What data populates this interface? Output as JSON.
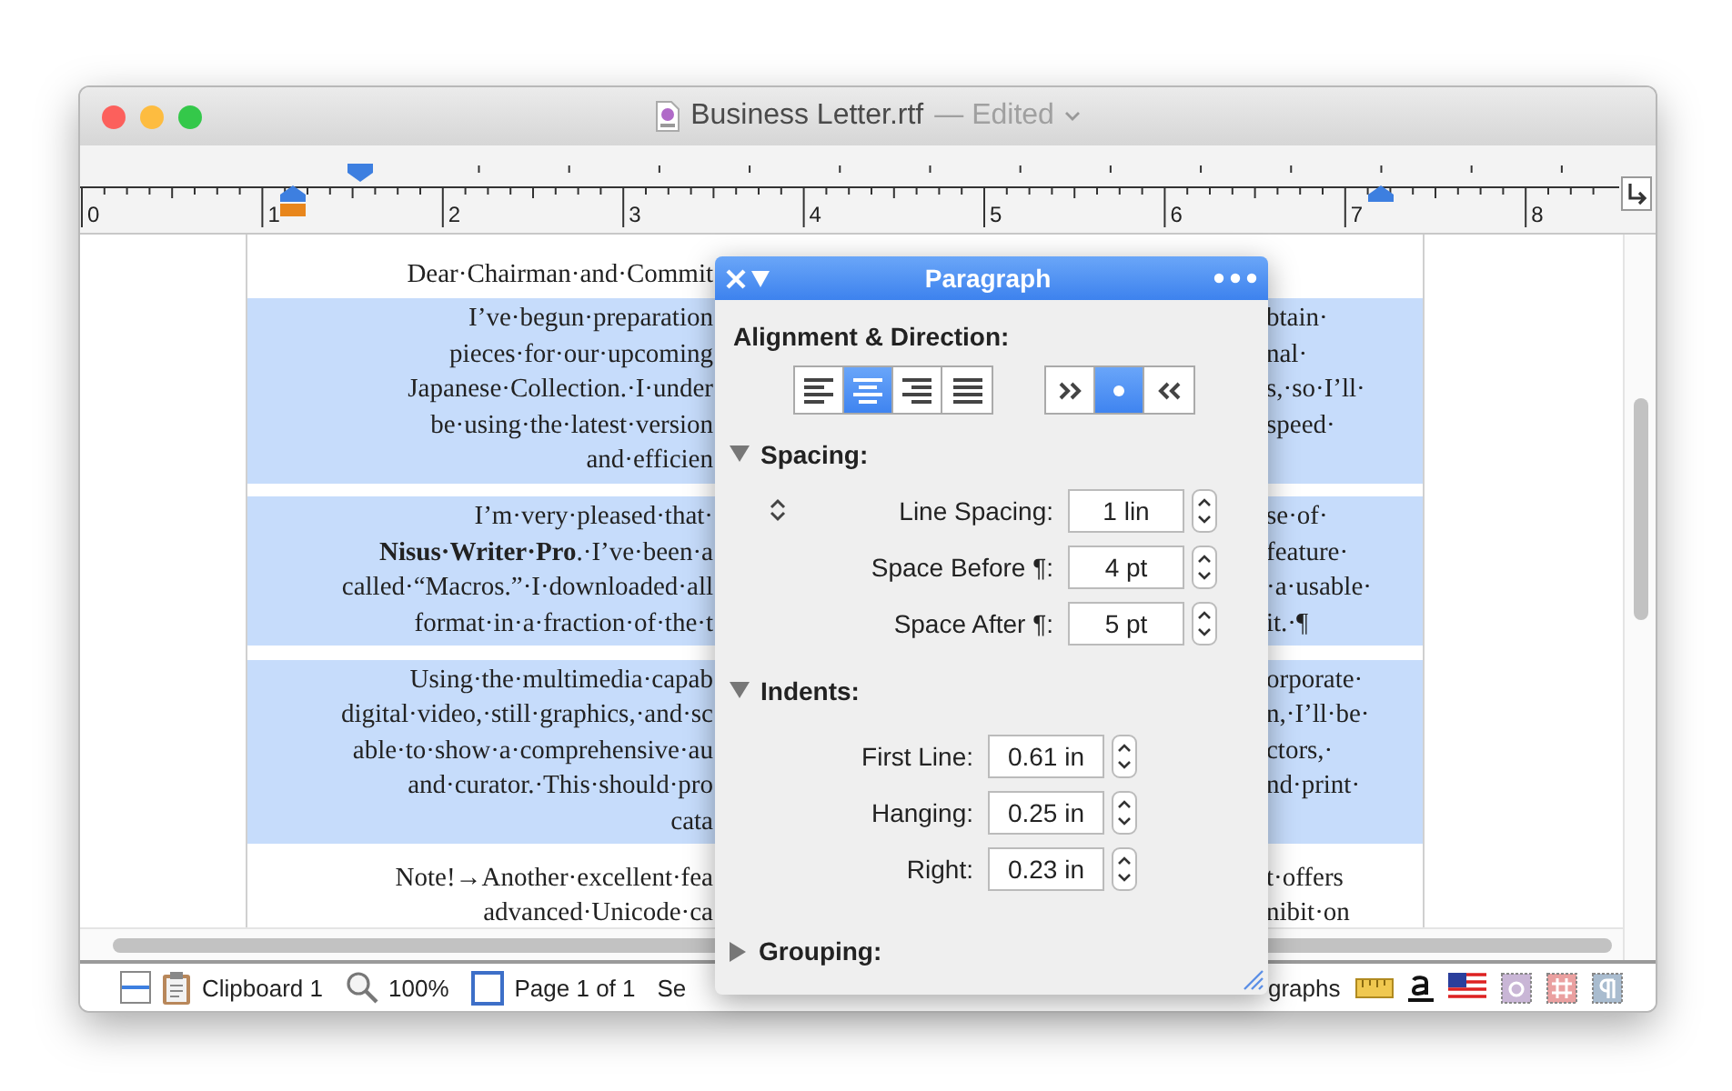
{
  "window": {
    "title": "Business Letter.rtf",
    "edited_label": "— Edited"
  },
  "ruler": {
    "numbers": [
      "0",
      "1",
      "2",
      "3",
      "4",
      "5",
      "6",
      "7",
      "8"
    ]
  },
  "document": {
    "paragraphs": [
      {
        "selected": false,
        "lines": [
          {
            "left": "Dear·Chairman·and·Commit"
          }
        ]
      },
      {
        "selected": true,
        "lines": [
          {
            "left": "I’ve·begun·preparation",
            "right": "btain·"
          },
          {
            "left": "pieces·for·our·upcoming",
            "right": "nal·"
          },
          {
            "left": "Japanese·Collection.·I·under",
            "right": "s,·so·I’ll·"
          },
          {
            "left": "be·using·the·latest·version",
            "right": "speed·"
          },
          {
            "left": "and·efficien"
          }
        ]
      },
      {
        "selected": true,
        "lines": [
          {
            "left": "I’m·very·pleased·that·",
            "right": "se·of·"
          },
          {
            "left": "**Nisus·Writer·Pro**.·I’ve·been·a",
            "right": "feature·"
          },
          {
            "left": "called·“Macros.”·I·downloaded·all",
            "right": "·a·usable·"
          },
          {
            "left": "format·in·a·fraction·of·the·t",
            "right": "it.·¶"
          }
        ]
      },
      {
        "selected": true,
        "lines": [
          {
            "left": "Using·the·multimedia·capab",
            "right": "orporate·"
          },
          {
            "left": "digital·video,·still·graphics,·and·sc",
            "right": "n,·I’ll·be·"
          },
          {
            "left": "able·to·show·a·comprehensive·au",
            "right": "ctors,·"
          },
          {
            "left": "and·curator.·This·should·pro",
            "right": "nd·print·"
          },
          {
            "left": "cata"
          }
        ]
      },
      {
        "selected": false,
        "lines": [
          {
            "left": "Note!→Another·excellent·fea",
            "right": "t·offers"
          },
          {
            "left": "advanced·Unicode·ca",
            "right": "nibit·on"
          }
        ]
      }
    ]
  },
  "status_bar": {
    "clipboard": "Clipboard 1",
    "zoom": "100%",
    "page": "Page 1 of 1",
    "section": "Se",
    "paragraph_styles": "graphs"
  },
  "panel": {
    "title": "Paragraph",
    "alignment_heading": "Alignment & Direction:",
    "alignment": [
      {
        "kind": "left",
        "selected": false
      },
      {
        "kind": "center",
        "selected": true
      },
      {
        "kind": "right",
        "selected": false
      },
      {
        "kind": "justify",
        "selected": false
      }
    ],
    "direction": [
      {
        "kind": "ltr",
        "selected": false
      },
      {
        "kind": "natural",
        "selected": true
      },
      {
        "kind": "rtl",
        "selected": false
      }
    ],
    "sections": [
      {
        "title": "Spacing:",
        "expanded": true,
        "kind": "spacing",
        "fields": [
          {
            "label": "Line Spacing:",
            "value": "1 lin"
          },
          {
            "label": "Space Before ¶:",
            "value": "4 pt"
          },
          {
            "label": "Space After ¶:",
            "value": "5 pt"
          }
        ]
      },
      {
        "title": "Indents:",
        "expanded": true,
        "kind": "indents",
        "fields": [
          {
            "label": "First Line:",
            "value": "0.61 in"
          },
          {
            "label": "Hanging:",
            "value": "0.25 in"
          },
          {
            "label": "Right:",
            "value": "0.23 in"
          }
        ]
      },
      {
        "title": "Grouping:",
        "expanded": false,
        "kind": "grouping"
      }
    ]
  }
}
